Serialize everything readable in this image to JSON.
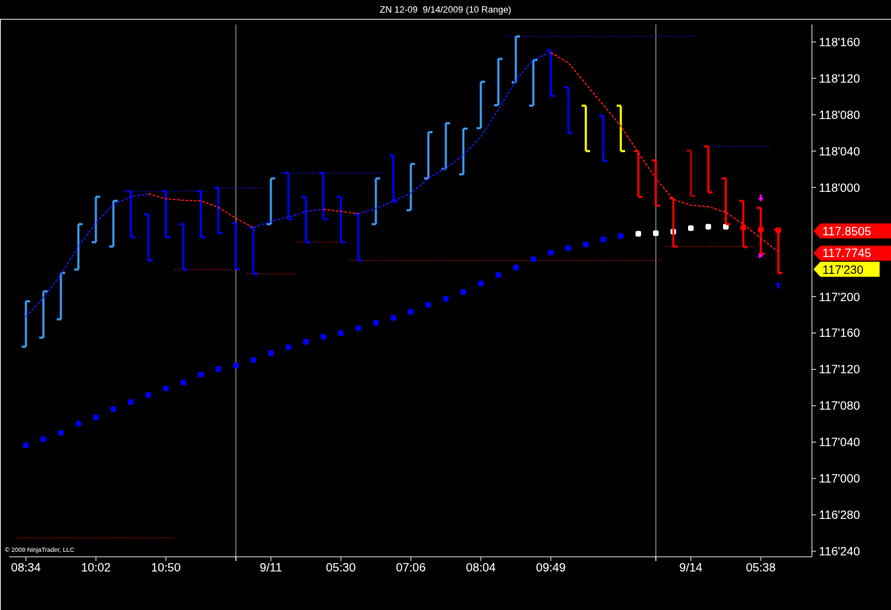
{
  "title": "ZN 12-09  9/14/2009 (10 Range)",
  "chart": {
    "x_axis_labels": [
      "08:34",
      "10:02",
      "10:50",
      "9/11",
      "05:30",
      "07:06",
      "08:04",
      "09:49",
      "9/14",
      "05:38"
    ],
    "y_axis_labels": [
      "118'160",
      "118'120",
      "118'080",
      "118'040",
      "118'000",
      "117'200",
      "117'160",
      "117'120",
      "117'080",
      "117'040",
      "117'000",
      "116'280",
      "116'240"
    ],
    "price_flags": [
      {
        "label": "117.8505",
        "color": "#ff0000"
      },
      {
        "label": "117.7745",
        "color": "#ff0000"
      },
      {
        "label": "117'230",
        "color": "#ffff00"
      }
    ],
    "copyright": "© 2009 NinjaTrader, LLC"
  }
}
